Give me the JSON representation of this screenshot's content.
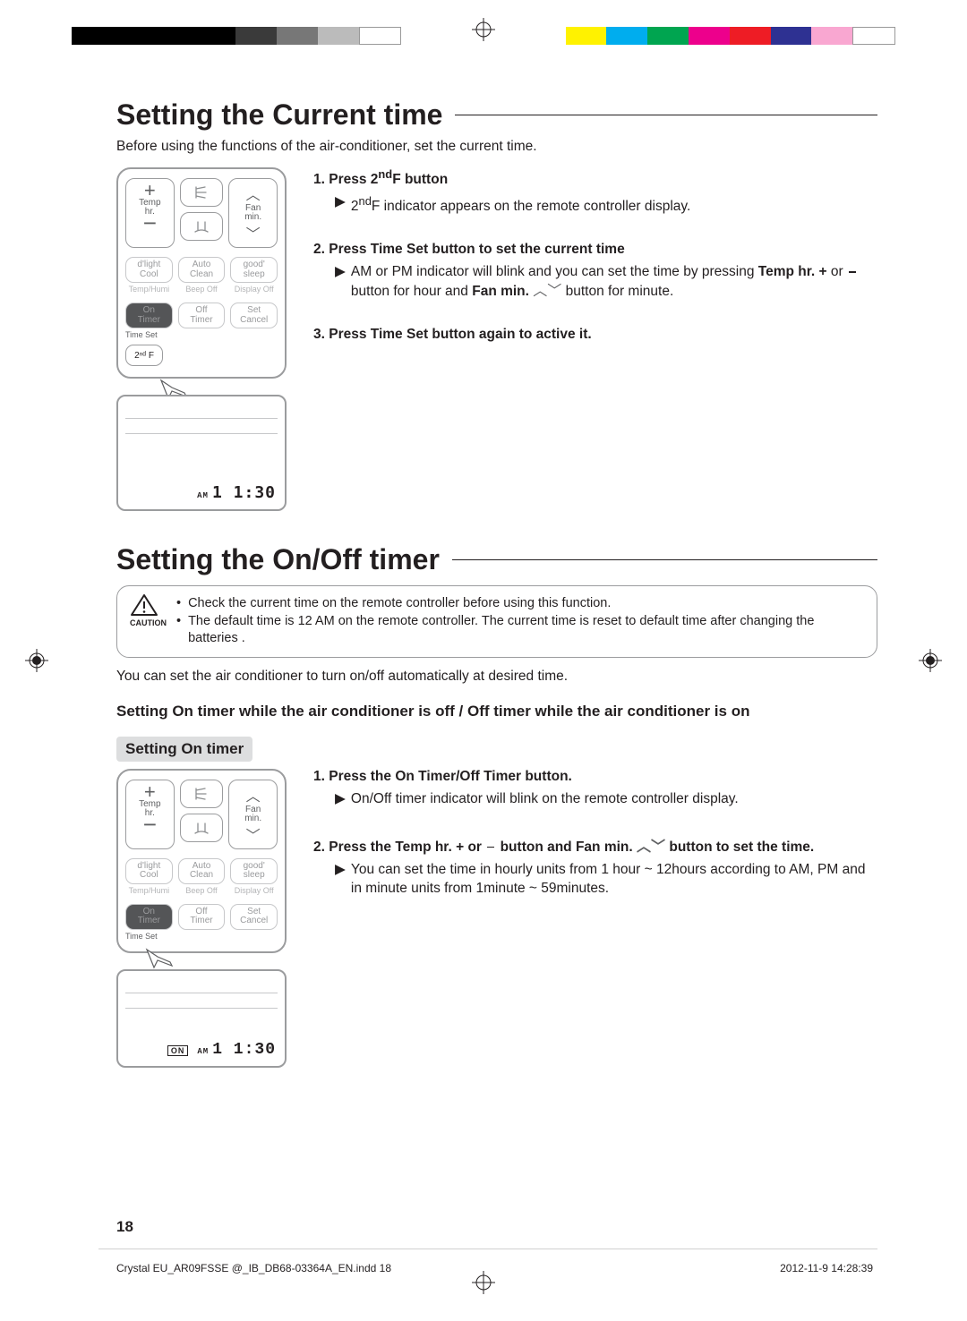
{
  "s1": {
    "title": "Setting the Current time",
    "intro": "Before using the functions of the air-conditioner, set the current time.",
    "steps": [
      {
        "t1": "Press",
        "t2": "2",
        "sup": "nd",
        "t3": "F button",
        "sub": "F indicator appears on the remote controller display."
      },
      {
        "t1": "Press",
        "b1": "Time Set",
        "t2": "button to set the current time",
        "sub1": "AM or PM indicator will blink and you can set the time by pressing",
        "b2": "Temp hr. +",
        "sub2": "or",
        "sub3": "button for hour and",
        "b3": "Fan min.",
        "sub4": " button for minute."
      },
      {
        "t1": "Press",
        "b1": "Time Set",
        "t2": "button again to active it."
      }
    ]
  },
  "s2": {
    "title": "Setting the On/Off timer",
    "cautionLabel": "CAUTION",
    "caution": [
      "Check the current time on the remote controller before using this function.",
      "The default time is 12 AM on the remote controller. The current time is reset to default time after changing the batteries ."
    ],
    "intro": "You can set the air conditioner to turn on/off automatically at desired time.",
    "subhead": "Setting On timer while the air conditioner is off / Off timer while the air conditioner is on",
    "pill": "Setting On timer",
    "steps": [
      {
        "t1": "Press the",
        "b1": "On Timer/Off Timer",
        "t2": "button.",
        "sub": "On/Off timer indicator will blink on the remote controller display."
      },
      {
        "t1": "Press the",
        "b1": "Temp hr. +",
        "t2": "or",
        "t3": "button and",
        "b2": "Fan min.",
        "t4": " button to set the time.",
        "sub": "You can set the time in hourly units from 1 hour ~ 12hours according to AM, PM and in minute units from 1minute ~ 59minutes."
      }
    ]
  },
  "remote": {
    "temp": "Temp",
    "hr": "hr.",
    "fan": "Fan",
    "min": "min.",
    "modes": [
      {
        "a": "d'light",
        "b": "Cool"
      },
      {
        "a": "Auto",
        "b": "Clean"
      },
      {
        "a": "good'",
        "b": "sleep"
      }
    ],
    "sub": [
      "Temp/Humi",
      "Beep Off",
      "Display Off"
    ],
    "timer": [
      {
        "a": "On",
        "b": "Timer"
      },
      {
        "a": "Off",
        "b": "Timer"
      },
      {
        "a": "Set",
        "b": "Cancel"
      }
    ],
    "timeset": "Time Set",
    "secondF": "2ⁿᵈ F"
  },
  "display1": {
    "am": "AM",
    "time": "1 1:30"
  },
  "display2": {
    "on": "ON",
    "am": "AM",
    "time": "1 1:30"
  },
  "footer": {
    "page": "18",
    "file": "Crystal EU_AR09FSSE @_IB_DB68-03364A_EN.indd   18",
    "ts": "2012-11-9   14:28:39"
  }
}
